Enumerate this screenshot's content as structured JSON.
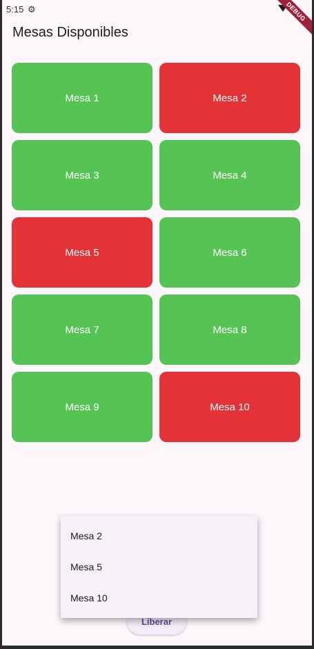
{
  "status_bar": {
    "time": "5:15",
    "settings_icon": "settings-gear-icon",
    "debug_label": "DEBUG"
  },
  "app": {
    "title": "Mesas Disponibles"
  },
  "colors": {
    "available": "#55c455",
    "occupied": "#e33336"
  },
  "tables": [
    {
      "label": "Mesa 1",
      "status": "available"
    },
    {
      "label": "Mesa 2",
      "status": "occupied"
    },
    {
      "label": "Mesa 3",
      "status": "available"
    },
    {
      "label": "Mesa 4",
      "status": "available"
    },
    {
      "label": "Mesa 5",
      "status": "occupied"
    },
    {
      "label": "Mesa 6",
      "status": "available"
    },
    {
      "label": "Mesa 7",
      "status": "available"
    },
    {
      "label": "Mesa 8",
      "status": "available"
    },
    {
      "label": "Mesa 9",
      "status": "available"
    },
    {
      "label": "Mesa 10",
      "status": "occupied"
    }
  ],
  "popup_menu": {
    "items": [
      "Mesa 2",
      "Mesa 5",
      "Mesa 10"
    ]
  },
  "release_button": {
    "label": "Liberar"
  }
}
